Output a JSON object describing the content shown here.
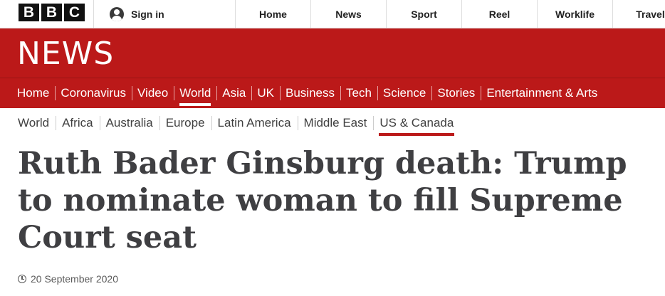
{
  "global_header": {
    "logo_letters": [
      "B",
      "B",
      "C"
    ],
    "sign_in_label": "Sign in",
    "nav": [
      "Home",
      "News",
      "Sport",
      "Reel",
      "Worklife",
      "Travel"
    ]
  },
  "news_header": {
    "brand": "NEWS",
    "brand_color": "#bb1919",
    "nav": [
      "Home",
      "Coronavirus",
      "Video",
      "World",
      "Asia",
      "UK",
      "Business",
      "Tech",
      "Science",
      "Stories",
      "Entertainment & Arts"
    ],
    "active_nav": "World"
  },
  "sub_nav": {
    "items": [
      "World",
      "Africa",
      "Australia",
      "Europe",
      "Latin America",
      "Middle East",
      "US & Canada"
    ],
    "active": "US & Canada"
  },
  "article": {
    "headline": "Ruth Bader Ginsburg death: Trump to nominate woman to fill Supreme Court seat",
    "date": "20 September 2020",
    "date_icon": "clock-icon"
  }
}
